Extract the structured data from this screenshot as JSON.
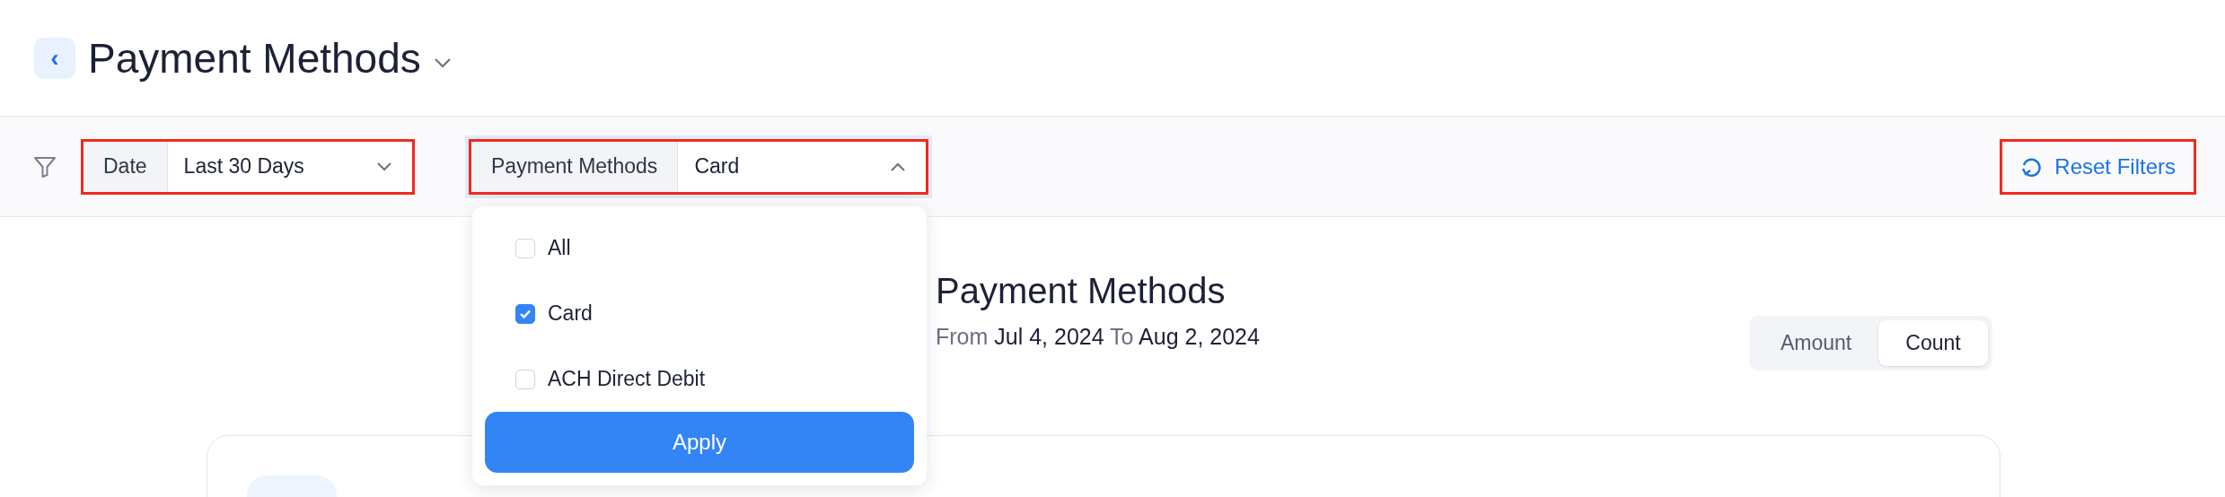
{
  "header": {
    "back_icon": "‹",
    "title": "Payment Methods"
  },
  "filters": [
    {
      "kind": "select",
      "label": "Date",
      "value": "Last 30 Days",
      "expanded": false,
      "highlighted": true
    },
    {
      "kind": "select",
      "label": "Payment Methods",
      "value": "Card",
      "expanded": true,
      "highlighted": true
    }
  ],
  "reset_button": {
    "label": "Reset Filters",
    "highlighted": true
  },
  "dropdown": {
    "options": [
      {
        "label": "All",
        "checked": false
      },
      {
        "label": "Card",
        "checked": true
      },
      {
        "label": "ACH Direct Debit",
        "checked": false
      }
    ],
    "apply_button": "Apply"
  },
  "report": {
    "title": "Payment Methods",
    "from_label": "From",
    "from_date": "Jul 4, 2024",
    "to_label": "To",
    "to_date": "Aug 2, 2024"
  },
  "view_toggle": [
    {
      "label": "Amount",
      "selected": false
    },
    {
      "label": "Count",
      "selected": true
    }
  ]
}
